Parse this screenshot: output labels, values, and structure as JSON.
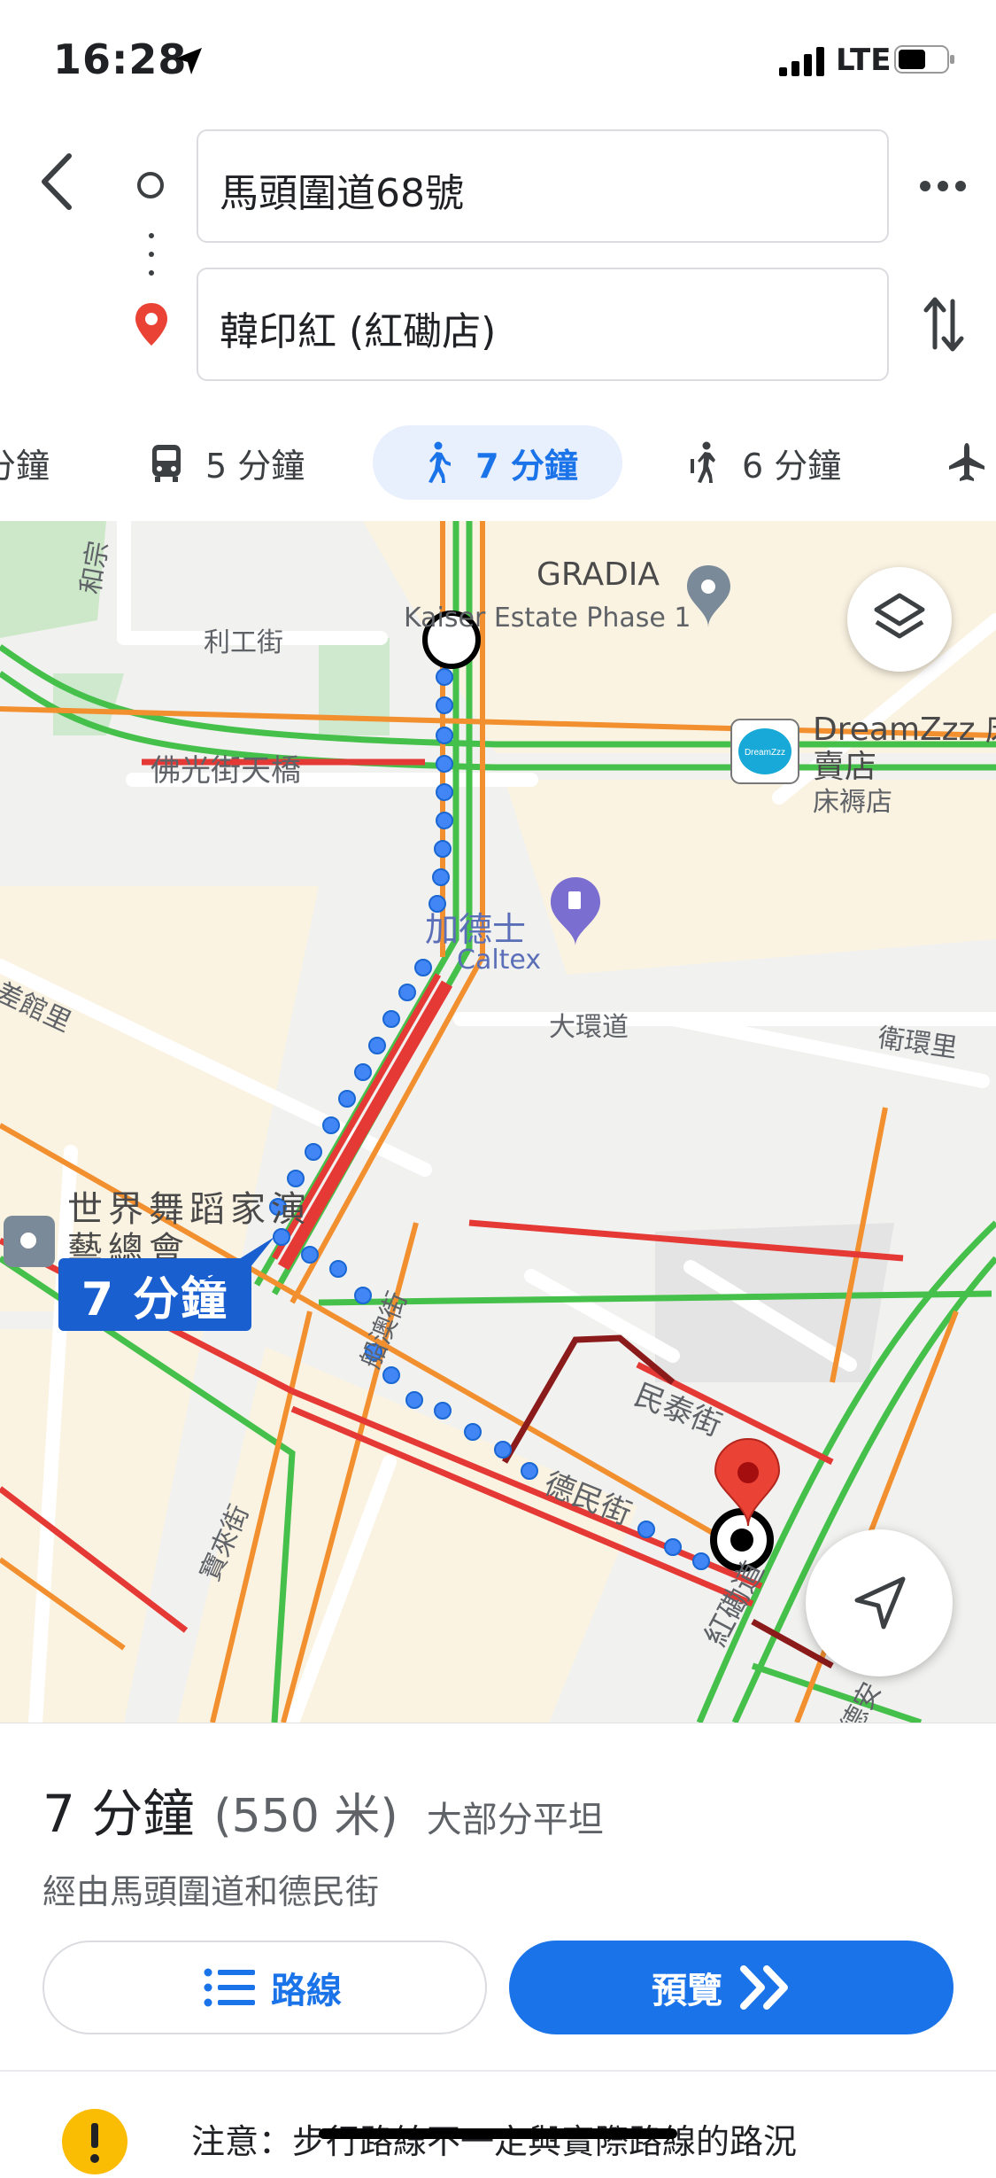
{
  "status_bar": {
    "time": "16:28",
    "network": "LTE"
  },
  "search": {
    "origin": "馬頭圍道68號",
    "destination": "韓印紅 (紅磡店)"
  },
  "modes": [
    {
      "name": "drive",
      "label": "分鐘"
    },
    {
      "name": "transit",
      "label": "5 分鐘"
    },
    {
      "name": "walk",
      "label": "7 分鐘",
      "selected": true
    },
    {
      "name": "ride",
      "label": "6 分鐘"
    },
    {
      "name": "flight",
      "label": ""
    }
  ],
  "map": {
    "labels": {
      "gradia": "GRADIA",
      "kaiser": "Kaiser Estate Phase 1",
      "li_kung": "利工街",
      "fat_kwong": "佛光街天橋",
      "dreamzzz": "DreamZzz 床",
      "dreamzzz_2": "賣店",
      "dreamzzz_3": "床褥店",
      "caltex_zh": "加德士",
      "caltex_en": "Caltex",
      "tai_wan": "大環道",
      "wai_wan": "衛環里",
      "chi_kwun": "差館里",
      "world_dance": "世界舞蹈家演",
      "world_dance_2": "藝總會",
      "man_tai": "民泰街",
      "tak_man": "德民街",
      "ship_yard": "船澳街",
      "hung_hom": "紅磡道",
      "bulk_st": "寶來街",
      "tak_on": "德安",
      "ho_man": "和宗"
    },
    "route_duration": "7 分鐘",
    "colors": {
      "route": "#4285f4",
      "traffic_slow": "#e53935",
      "traffic_mid": "#fb8c00",
      "traffic_free": "#43c24f"
    }
  },
  "summary": {
    "duration": "7 分鐘",
    "distance": "(550 米)",
    "terrain": "大部分平坦",
    "via": "經由馬頭圍道和德民街"
  },
  "buttons": {
    "steps": "路線",
    "preview": "預覽"
  },
  "notice": "注意：步行路線不一定與實際路線的路況"
}
